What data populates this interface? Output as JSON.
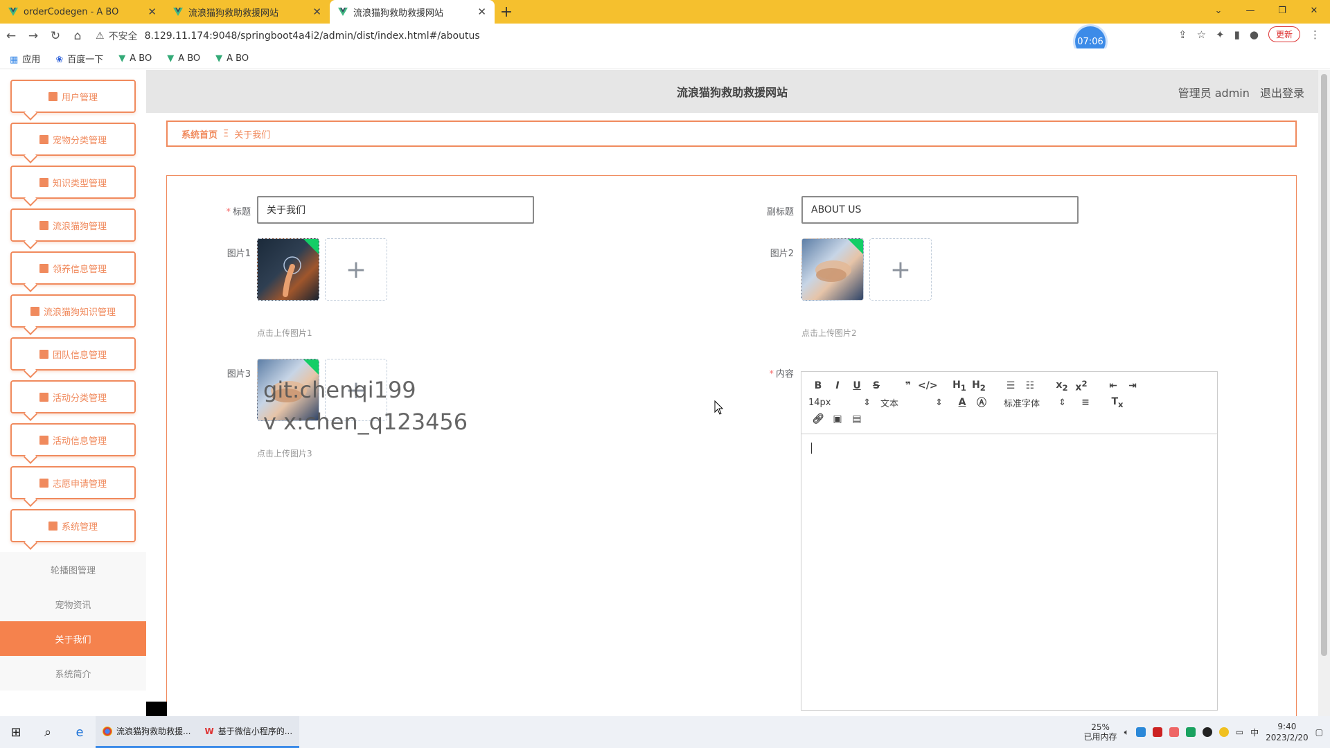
{
  "browser": {
    "tabs": [
      {
        "title": "orderCodegen - A BO",
        "active": false
      },
      {
        "title": "流浪猫狗救助救援网站",
        "active": false
      },
      {
        "title": "流浪猫狗救助救援网站",
        "active": true
      }
    ],
    "new_tab": "+",
    "insecure_label": "不安全",
    "url": "8.129.11.174:9048/springboot4a4i2/admin/dist/index.html#/aboutus",
    "timer": "07:06",
    "update_label": "更新",
    "bookmarks": [
      "应用",
      "百度一下",
      "A BO",
      "A BO",
      "A BO"
    ]
  },
  "header": {
    "site_title": "流浪猫狗救助救援网站",
    "role": "管理员 admin",
    "logout": "退出登录"
  },
  "sidebar": {
    "items": [
      {
        "label": "用户管理"
      },
      {
        "label": "宠物分类管理"
      },
      {
        "label": "知识类型管理"
      },
      {
        "label": "流浪猫狗管理"
      },
      {
        "label": "领养信息管理"
      },
      {
        "label": "流浪猫狗知识管理"
      },
      {
        "label": "团队信息管理"
      },
      {
        "label": "活动分类管理"
      },
      {
        "label": "活动信息管理"
      },
      {
        "label": "志愿申请管理"
      },
      {
        "label": "系统管理"
      }
    ],
    "submenu": [
      {
        "label": "轮播图管理",
        "active": false
      },
      {
        "label": "宠物资讯",
        "active": false
      },
      {
        "label": "关于我们",
        "active": true
      },
      {
        "label": "系统简介",
        "active": false
      }
    ]
  },
  "breadcrumb": {
    "home": "系统首页",
    "separator": "Ξ",
    "current": "关于我们"
  },
  "form": {
    "title_label": "标题",
    "title_value": "关于我们",
    "subtitle_label": "副标题",
    "subtitle_value": "ABOUT US",
    "image1_label": "图片1",
    "image1_tip": "点击上传图片1",
    "image2_label": "图片2",
    "image2_tip": "点击上传图片2",
    "image3_label": "图片3",
    "image3_tip": "点击上传图片3",
    "content_label": "内容",
    "watermark_line1": "git:chenqi199",
    "watermark_line2": "v x:chen_q123456"
  },
  "editor": {
    "font_size": "14px",
    "text_type": "文本",
    "font_family": "标准字体"
  },
  "taskbar": {
    "apps": [
      "流浪猫狗救助救援...",
      "基于微信小程序的..."
    ],
    "memory_pct": "25%",
    "memory_label": "已用内存",
    "ime": "中",
    "time": "9:40",
    "date": "2023/2/20"
  }
}
